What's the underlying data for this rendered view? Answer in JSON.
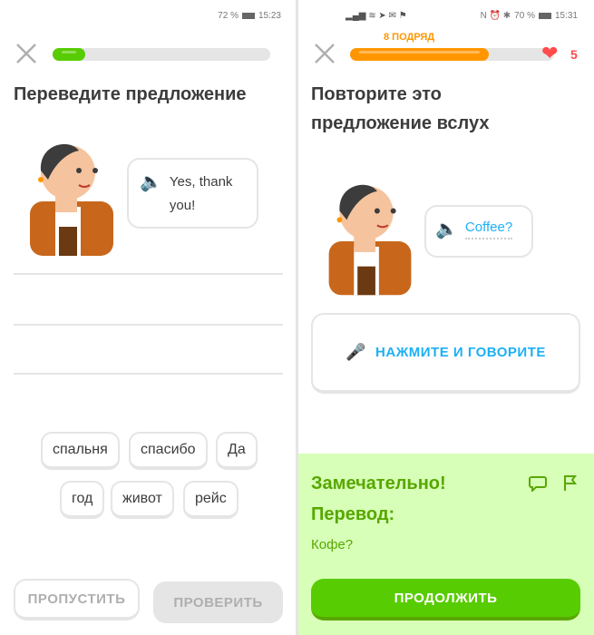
{
  "left": {
    "status": {
      "battery": "72 %",
      "time": "15:23"
    },
    "progress_percent": 15,
    "title": "Переведите предложение",
    "speech": "Yes, thank you!",
    "word_bank": [
      "спальня",
      "спасибо",
      "Да",
      "год",
      "живот",
      "рейс"
    ],
    "skip_label": "ПРОПУСТИТЬ",
    "check_label": "ПРОВЕРИТЬ"
  },
  "right": {
    "status": {
      "battery": "70 %",
      "time": "15:31"
    },
    "streak_label": "8 ПОДРЯД",
    "progress_percent": 68,
    "hearts": "5",
    "title_line1": "Повторите это",
    "title_line2": "предложение вслух",
    "speech": "Coffee?",
    "speak_label": "НАЖМИТЕ И ГОВОРИТЕ",
    "feedback_title": "Замечательно!",
    "translation_label": "Перевод:",
    "translation": "Кофе?",
    "continue_label": "ПРОДОЛЖИТЬ"
  },
  "colors": {
    "green": "#58cc02",
    "orange": "#ff9600",
    "blue": "#1cb0f6",
    "red": "#ff4b4b",
    "feedback_bg": "#d7ffb8",
    "feedback_text": "#58a700"
  }
}
